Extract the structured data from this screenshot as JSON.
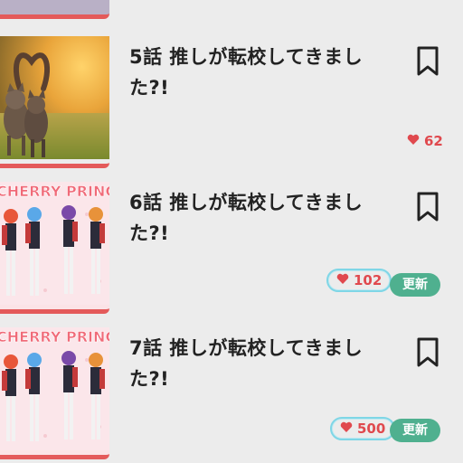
{
  "episodes": [
    {
      "title": "5話 推しが転校してきました?!",
      "likes": "62",
      "badge": "",
      "thumb": "cats"
    },
    {
      "title": "6話 推しが転校してきました?!",
      "likes": "102",
      "badge": "更新",
      "thumb": "idols"
    },
    {
      "title": "7話 推しが転校してきました?!",
      "likes": "500",
      "badge": "更新",
      "thumb": "idols"
    }
  ],
  "thumb_text": "CHERRY PRINC",
  "colors": {
    "accent_red": "#e45a5a",
    "like_red": "#e0494e",
    "badge_green": "#4fb08f",
    "highlight_cyan": "#7fd6e6",
    "background": "#ececec"
  },
  "icons": {
    "bookmark": "bookmark-icon",
    "like": "heart-icon"
  }
}
